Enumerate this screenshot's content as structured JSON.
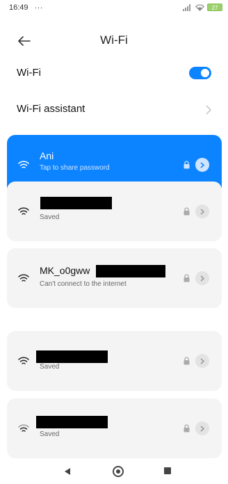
{
  "status_bar": {
    "time": "16:49",
    "more": "...",
    "battery": "27"
  },
  "header": {
    "title": "Wi-Fi"
  },
  "settings": {
    "wifi_label": "Wi-Fi",
    "wifi_enabled": true,
    "assistant_label": "Wi-Fi assistant"
  },
  "networks": [
    {
      "name": "Ani",
      "status": "Tap to share password",
      "connected": true,
      "secured": true
    },
    {
      "name": "",
      "status": "Saved",
      "connected": false,
      "secured": true
    },
    {
      "name": "MK_o0gww",
      "status": "Can't connect to the internet",
      "connected": false,
      "secured": true
    },
    {
      "name": "",
      "status": "Saved",
      "connected": false,
      "secured": true
    },
    {
      "name": "",
      "status": "Saved",
      "connected": false,
      "secured": true
    }
  ],
  "colors": {
    "accent": "#0d84ff",
    "card_bg": "#f4f4f4"
  },
  "icons": {
    "back": "arrow-left-icon",
    "wifi": "wifi-icon",
    "lock": "lock-icon",
    "detail": "chevron-right-icon",
    "nav_back": "triangle-back-icon",
    "nav_home": "circle-home-icon",
    "nav_recent": "square-recent-icon"
  }
}
